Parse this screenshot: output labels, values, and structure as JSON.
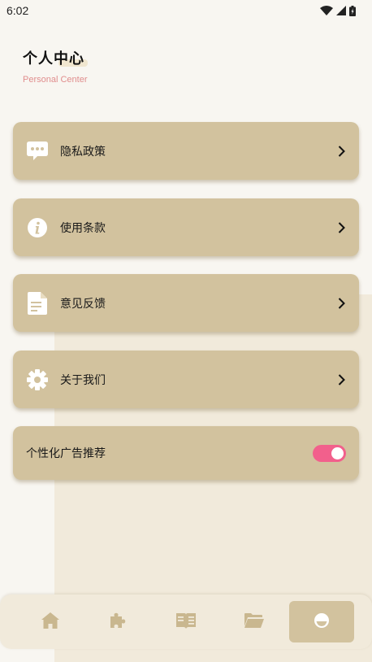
{
  "status_bar": {
    "time": "6:02",
    "icons": [
      "wifi-icon",
      "signal-icon",
      "battery-icon"
    ]
  },
  "header": {
    "title": "个人中心",
    "subtitle": "Personal Center"
  },
  "menu": {
    "items": [
      {
        "label": "隐私政策",
        "icon": "chat-bubble-icon"
      },
      {
        "label": "使用条款",
        "icon": "info-icon"
      },
      {
        "label": "意见反馈",
        "icon": "document-icon"
      },
      {
        "label": "关于我们",
        "icon": "gear-icon"
      }
    ]
  },
  "ad_toggle": {
    "label": "个性化广告推荐",
    "enabled": true
  },
  "bottom_nav": {
    "items": [
      {
        "icon": "home-icon"
      },
      {
        "icon": "puzzle-icon"
      },
      {
        "icon": "book-icon"
      },
      {
        "icon": "folder-icon"
      },
      {
        "icon": "profile-face-icon",
        "active": true
      }
    ]
  },
  "colors": {
    "background": "#f8f6f1",
    "card": "#d2c29e",
    "nav_bar": "#f1eadb",
    "subtitle": "#e08d8d",
    "switch_on": "#f2608c",
    "nav_icon": "#c9b78f"
  }
}
